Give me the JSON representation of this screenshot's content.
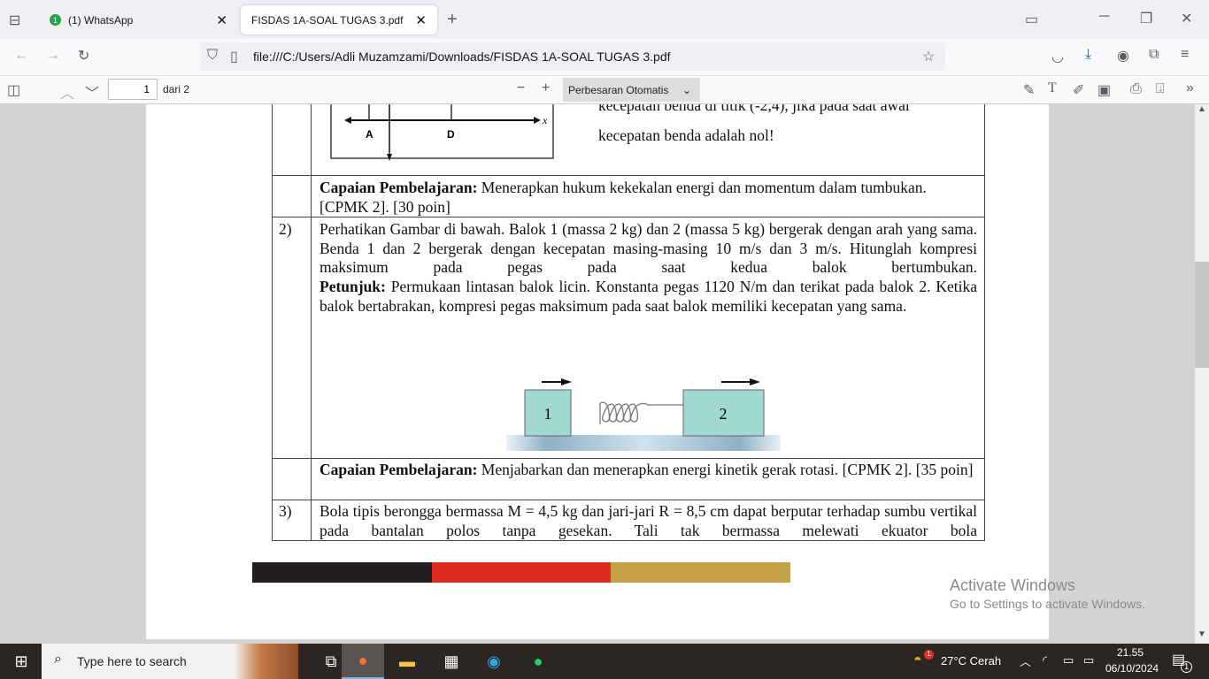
{
  "browser": {
    "tabs": [
      {
        "label": "(1) WhatsApp",
        "badge": "1"
      },
      {
        "label": "FISDAS 1A-SOAL TUGAS 3.pdf"
      }
    ],
    "url": "file:///C:/Users/Adli Muzamzami/Downloads/FISDAS 1A-SOAL TUGAS 3.pdf"
  },
  "pdf_toolbar": {
    "page": "1",
    "page_of": "dari 2",
    "zoom": "Perbesaran Otomatis"
  },
  "document": {
    "fig_top": {
      "axis_x": "x",
      "label_a": "A",
      "label_d": "D"
    },
    "row0_text1": "kecepatan benda di titik (-2,4), jika pada saat awal",
    "row0_text2": "kecepatan benda adalah nol!",
    "cp1_bold": "Capaian Pembelajaran:",
    "cp1_text": " Menerapkan hukum kekekalan energi dan momentum dalam tumbukan. [CPMK 2]. [30 poin]",
    "q2_num": "2)",
    "q2_text": "Perhatikan Gambar di bawah. Balok 1 (massa 2 kg) dan 2 (massa 5 kg) bergerak dengan arah yang sama. Benda 1 dan 2 bergerak dengan kecepatan masing-masing 10 m/s dan 3 m/s. Hitunglah kompresi maksimum pada pegas pada saat kedua balok bertumbukan.",
    "q2_hint_bold": "Petunjuk:",
    "q2_hint": " Permukaan lintasan balok licin. Konstanta pegas 1120 N/m dan terikat pada balok 2. Ketika balok bertabrakan, kompresi pegas maksimum pada saat balok memiliki kecepatan yang sama.",
    "block1": "1",
    "block2": "2",
    "cp2_bold": "Capaian Pembelajaran:",
    "cp2_text": " Menjabarkan dan menerapkan energi kinetik gerak rotasi. [CPMK 2]. [35 poin]",
    "q3_num": "3)",
    "q3_text": "Bola tipis berongga bermassa M = 4,5 kg dan jari-jari R = 8,5 cm dapat berputar terhadap sumbu vertikal pada bantalan polos tanpa gesekan. Tali tak bermassa melewati ekuator bola",
    "stripe_colors": [
      "#231f20",
      "#dc2a1f",
      "#c4a044"
    ]
  },
  "watermark": {
    "title": "Activate Windows",
    "subtitle": "Go to Settings to activate Windows."
  },
  "taskbar": {
    "search_placeholder": "Type here to search",
    "weather": "27°C  Cerah",
    "weather_badge": "1",
    "time": "21.55",
    "date": "06/10/2024",
    "notif_count": "1"
  }
}
